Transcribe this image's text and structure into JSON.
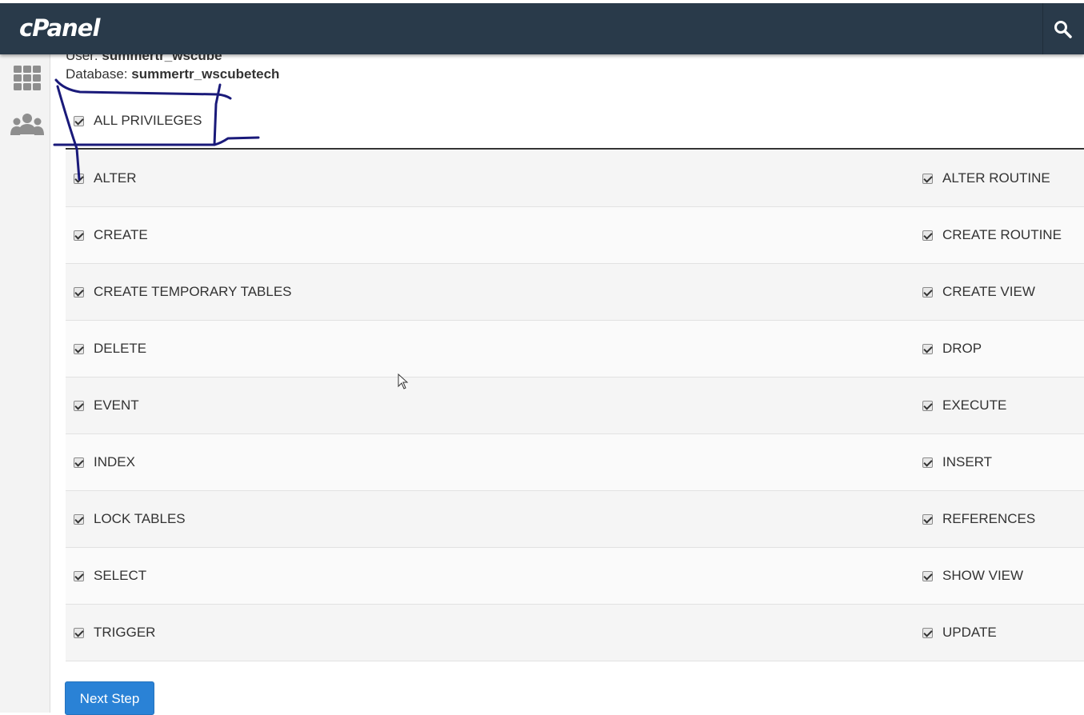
{
  "header": {
    "logo": "cPanel",
    "search_icon": "search-icon"
  },
  "sidebar": {
    "icons": [
      "grid-icon",
      "users-icon"
    ]
  },
  "meta": {
    "user_label": "User:",
    "user_value": "summertr_wscube",
    "db_label": "Database:",
    "db_value": "summertr_wscubetech"
  },
  "all_privileges": {
    "label": "ALL PRIVILEGES",
    "checked": true
  },
  "privileges": [
    {
      "left": "ALTER",
      "right": "ALTER ROUTINE"
    },
    {
      "left": "CREATE",
      "right": "CREATE ROUTINE"
    },
    {
      "left": "CREATE TEMPORARY TABLES",
      "right": "CREATE VIEW"
    },
    {
      "left": "DELETE",
      "right": "DROP"
    },
    {
      "left": "EVENT",
      "right": "EXECUTE"
    },
    {
      "left": "INDEX",
      "right": "INSERT"
    },
    {
      "left": "LOCK TABLES",
      "right": "REFERENCES"
    },
    {
      "left": "SELECT",
      "right": "SHOW VIEW"
    },
    {
      "left": "TRIGGER",
      "right": "UPDATE"
    }
  ],
  "buttons": {
    "next_step": "Next Step"
  },
  "colors": {
    "header_bg": "#293a4a",
    "button_bg": "#2a82d6",
    "annotation_ink": "#1a1a7a"
  }
}
